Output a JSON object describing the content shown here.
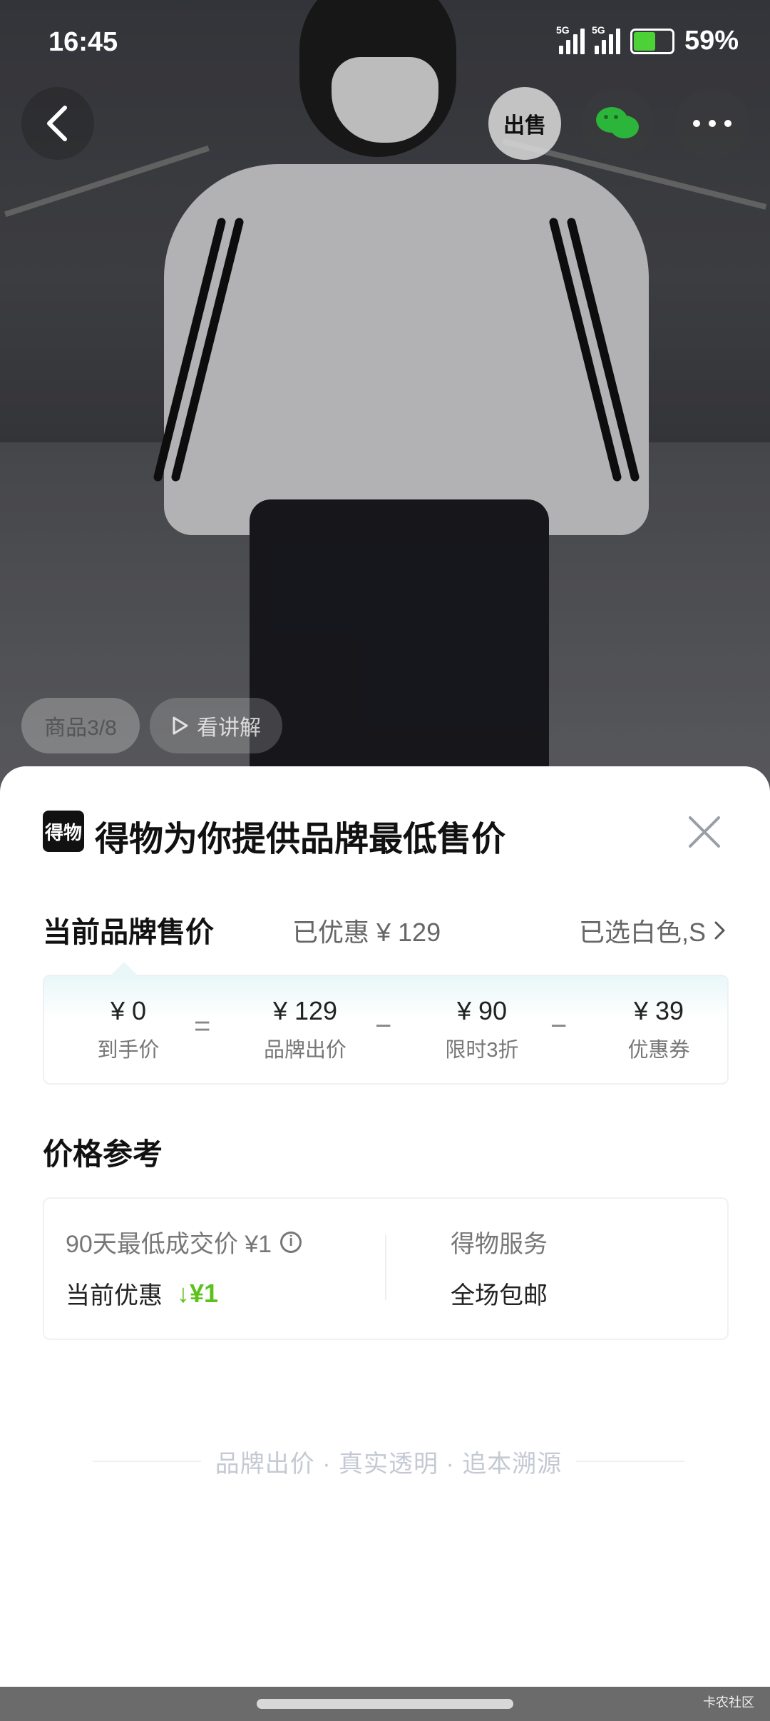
{
  "status_bar": {
    "time": "16:45",
    "battery": "59%",
    "network1": "5G",
    "network2": "5G"
  },
  "top_actions": {
    "sell_label": "出售"
  },
  "media": {
    "counter": "商品3/8",
    "video_label": "看讲解"
  },
  "sheet": {
    "logo_text": "得物",
    "title": "得物为你提供品牌最低售价",
    "current_label": "当前品牌售价",
    "discount_text": "已优惠 ¥ 129",
    "selected_text": "已选白色,S",
    "breakdown": [
      {
        "value": "¥ 0",
        "label": "到手价"
      },
      {
        "value": "¥ 129",
        "label": "品牌出价"
      },
      {
        "value": "¥ 90",
        "label": "限时3折"
      },
      {
        "value": "¥ 39",
        "label": "优惠券"
      }
    ],
    "operators": [
      "=",
      "−",
      "−"
    ],
    "ref_title": "价格参考",
    "low_price_text": "90天最低成交价 ¥1",
    "current_discount_label": "当前优惠",
    "current_discount_value": "↓¥1",
    "service_title": "得物服务",
    "service_value": "全场包邮",
    "footer": "品牌出价 · 真实透明 · 追本溯源"
  },
  "watermark": "卡农社区",
  "colors": {
    "accent_green": "#5cc21b",
    "battery_green": "#4cd137"
  }
}
